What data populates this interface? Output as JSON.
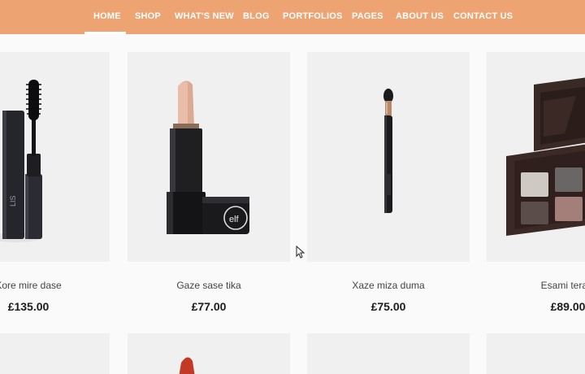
{
  "nav": {
    "items": [
      {
        "label": "HOME",
        "active": true
      },
      {
        "label": "SHOP"
      },
      {
        "label": "WHAT'S NEW"
      },
      {
        "label": "BLOG"
      },
      {
        "label": "PORTFOLIOS"
      },
      {
        "label": "PAGES"
      },
      {
        "label": "ABOUT US"
      },
      {
        "label": "CONTACT US"
      }
    ]
  },
  "products": [
    {
      "name": "Kore mire dase",
      "price": "£135.00",
      "icon": "mascara-icon"
    },
    {
      "name": "Gaze sase tika",
      "price": "£77.00",
      "icon": "lipstick-icon"
    },
    {
      "name": "Xaze miza duma",
      "price": "£75.00",
      "icon": "makeup-brush-icon"
    },
    {
      "name": "Esami tera s",
      "price": "£89.00",
      "icon": "eyeshadow-palette-icon"
    }
  ],
  "colors": {
    "nav": "#eea372",
    "card": "#f1f0f0",
    "page": "#fbfafa"
  }
}
